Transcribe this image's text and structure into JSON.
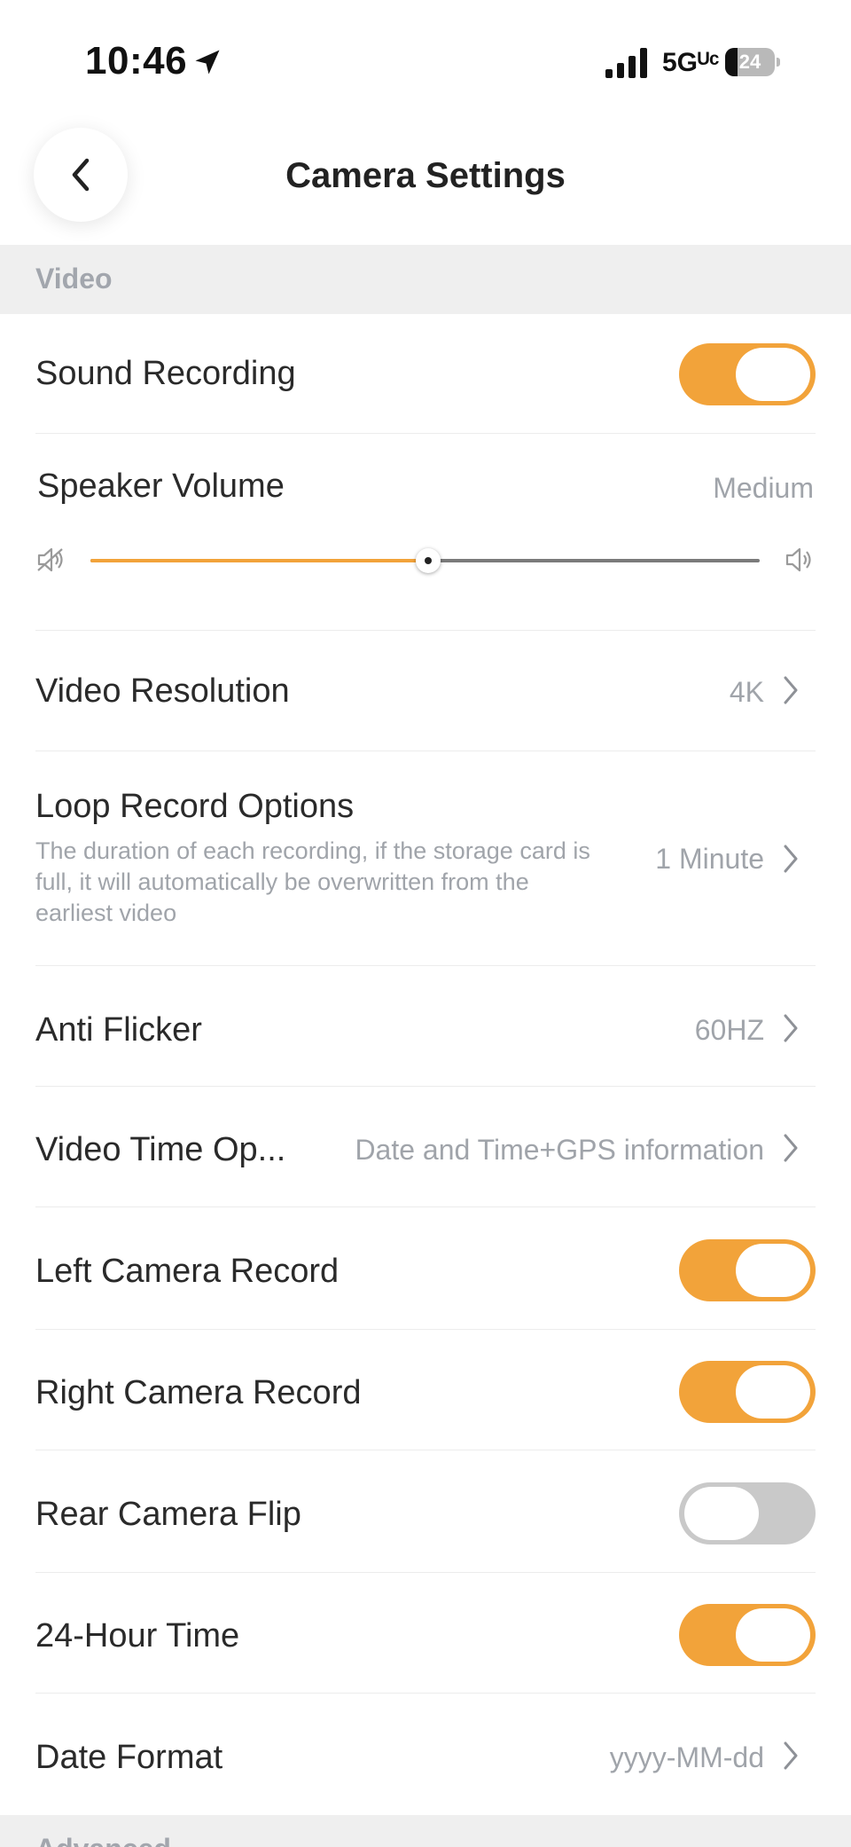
{
  "status_bar": {
    "time": "10:46",
    "network": "5Gᵁᶜ",
    "battery": "24"
  },
  "header": {
    "title": "Camera Settings",
    "back_icon": "chevron-left-icon"
  },
  "sections": {
    "video": "Video",
    "advanced": "Advanced"
  },
  "settings": {
    "sound_recording": {
      "label": "Sound Recording",
      "on": true
    },
    "speaker_volume": {
      "label": "Speaker Volume",
      "value": "Medium",
      "level": 0.505
    },
    "video_resolution": {
      "label": "Video Resolution",
      "value": "4K"
    },
    "loop_record": {
      "label": "Loop Record Options",
      "description": "The duration of each recording, if the storage card is full, it will automatically be overwritten from the earliest video",
      "value": "1 Minute"
    },
    "anti_flicker": {
      "label": "Anti Flicker",
      "value": "60HZ"
    },
    "video_time": {
      "label": "Video Time Op...",
      "value": "Date and Time+GPS information"
    },
    "left_camera": {
      "label": "Left Camera Record",
      "on": true
    },
    "right_camera": {
      "label": "Right Camera Record",
      "on": true
    },
    "rear_flip": {
      "label": "Rear Camera Flip",
      "on": false
    },
    "hour24": {
      "label": "24-Hour Time",
      "on": true
    },
    "date_format": {
      "label": "Date Format",
      "value": "yyyy-MM-dd"
    }
  },
  "colors": {
    "accent": "#f2a33a",
    "toggle_off": "#c9c9c9",
    "section_bg": "#efefef",
    "muted_text": "#a0a4aa"
  }
}
